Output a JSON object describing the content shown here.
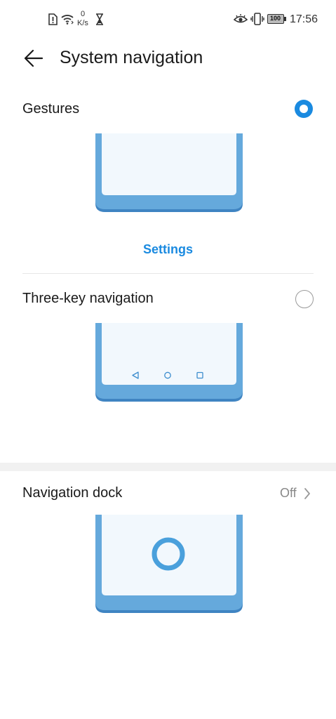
{
  "status_bar": {
    "net_speed_value": "0",
    "net_speed_unit": "K/s",
    "battery": "100",
    "time": "17:56"
  },
  "header": {
    "title": "System navigation"
  },
  "options": [
    {
      "label": "Gestures",
      "selected": true,
      "settings_label": "Settings"
    },
    {
      "label": "Three-key navigation",
      "selected": false
    }
  ],
  "navigation_dock": {
    "label": "Navigation dock",
    "value": "Off"
  },
  "colors": {
    "accent": "#1a8ae0",
    "phone_frame": "#65a9dc",
    "phone_frame_dark": "#3f84c2",
    "phone_screen": "#f2f8fd"
  },
  "icons": [
    "sim-alert-icon",
    "wifi-icon",
    "hourglass-icon",
    "eye-comfort-icon",
    "vibrate-icon",
    "battery-icon",
    "back-arrow-icon",
    "chevron-right-icon"
  ]
}
